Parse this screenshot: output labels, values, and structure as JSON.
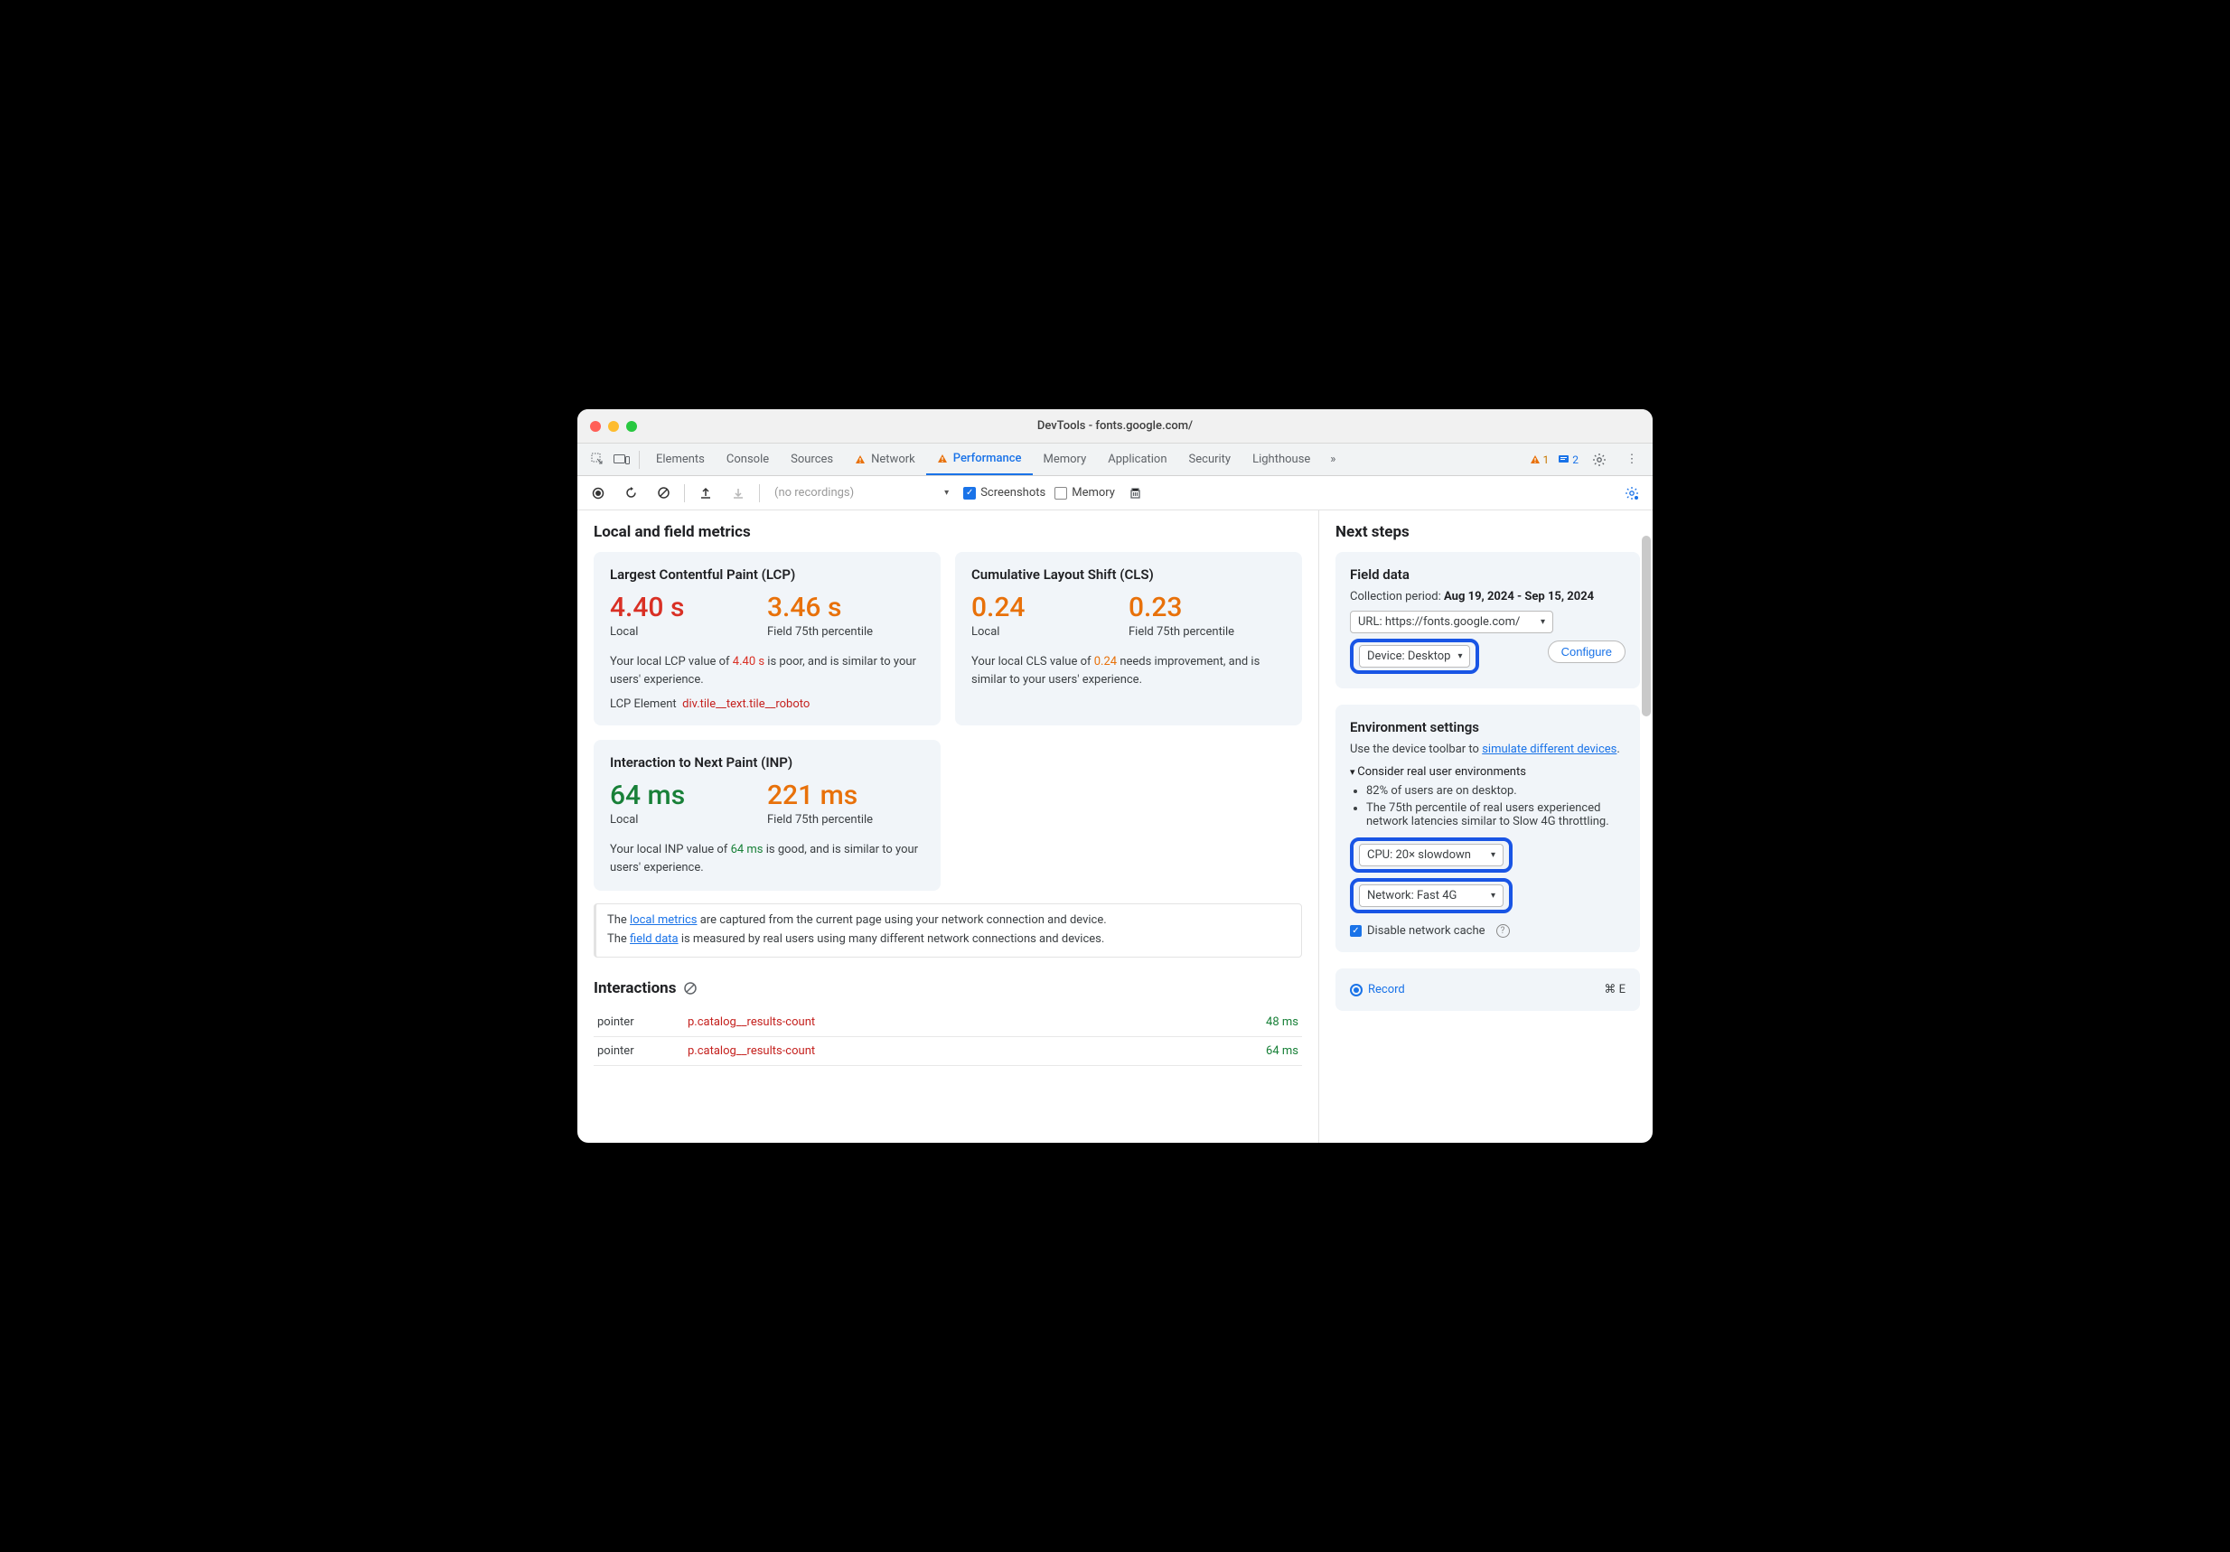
{
  "window_title": "DevTools - fonts.google.com/",
  "tabs": {
    "elements": "Elements",
    "console": "Console",
    "sources": "Sources",
    "network": "Network",
    "performance": "Performance",
    "memory": "Memory",
    "application": "Application",
    "security": "Security",
    "lighthouse": "Lighthouse"
  },
  "topright": {
    "warn_count": "1",
    "info_count": "2"
  },
  "toolbar": {
    "no_recordings": "(no recordings)",
    "screenshots": "Screenshots",
    "memory": "Memory"
  },
  "sections": {
    "local_field": "Local and field metrics",
    "interactions": "Interactions",
    "next_steps": "Next steps"
  },
  "lcp": {
    "title": "Largest Contentful Paint (LCP)",
    "local_val": "4.40 s",
    "field_val": "3.46 s",
    "local_lab": "Local",
    "field_lab": "Field 75th percentile",
    "desc_pre": "Your local LCP value of ",
    "desc_val": "4.40 s",
    "desc_post": " is poor, and is similar to your users' experience.",
    "el_label": "LCP Element",
    "el_sel": "div.tile__text.tile__roboto"
  },
  "cls": {
    "title": "Cumulative Layout Shift (CLS)",
    "local_val": "0.24",
    "field_val": "0.23",
    "local_lab": "Local",
    "field_lab": "Field 75th percentile",
    "desc_pre": "Your local CLS value of ",
    "desc_val": "0.24",
    "desc_post": " needs improvement, and is similar to your users' experience."
  },
  "inp": {
    "title": "Interaction to Next Paint (INP)",
    "local_val": "64 ms",
    "field_val": "221 ms",
    "local_lab": "Local",
    "field_lab": "Field 75th percentile",
    "desc_pre": "Your local INP value of ",
    "desc_val": "64 ms",
    "desc_post": " is good, and is similar to your users' experience."
  },
  "infobox": {
    "l1a": "The ",
    "l1link": "local metrics",
    "l1b": " are captured from the current page using your network connection and device.",
    "l2a": "The ",
    "l2link": "field data",
    "l2b": " is measured by real users using many different network connections and devices."
  },
  "interactions": [
    {
      "kind": "pointer",
      "sel": "p.catalog__results-count",
      "ms": "48 ms"
    },
    {
      "kind": "pointer",
      "sel": "p.catalog__results-count",
      "ms": "64 ms"
    }
  ],
  "field_data": {
    "title": "Field data",
    "period_lab": "Collection period: ",
    "period_val": "Aug 19, 2024 - Sep 15, 2024",
    "url": "URL: https://fonts.google.com/",
    "device": "Device: Desktop",
    "configure": "Configure"
  },
  "env": {
    "title": "Environment settings",
    "hint_pre": "Use the device toolbar to ",
    "hint_link": "simulate different devices",
    "hint_post": ".",
    "consider": "Consider real user environments",
    "bullet1": "82% of users are on desktop.",
    "bullet2": "The 75th percentile of real users experienced network latencies similar to Slow 4G throttling.",
    "cpu": "CPU: 20× slowdown",
    "net": "Network: Fast 4G",
    "disable_cache": "Disable network cache"
  },
  "record": {
    "label": "Record",
    "shortcut": "⌘ E"
  }
}
